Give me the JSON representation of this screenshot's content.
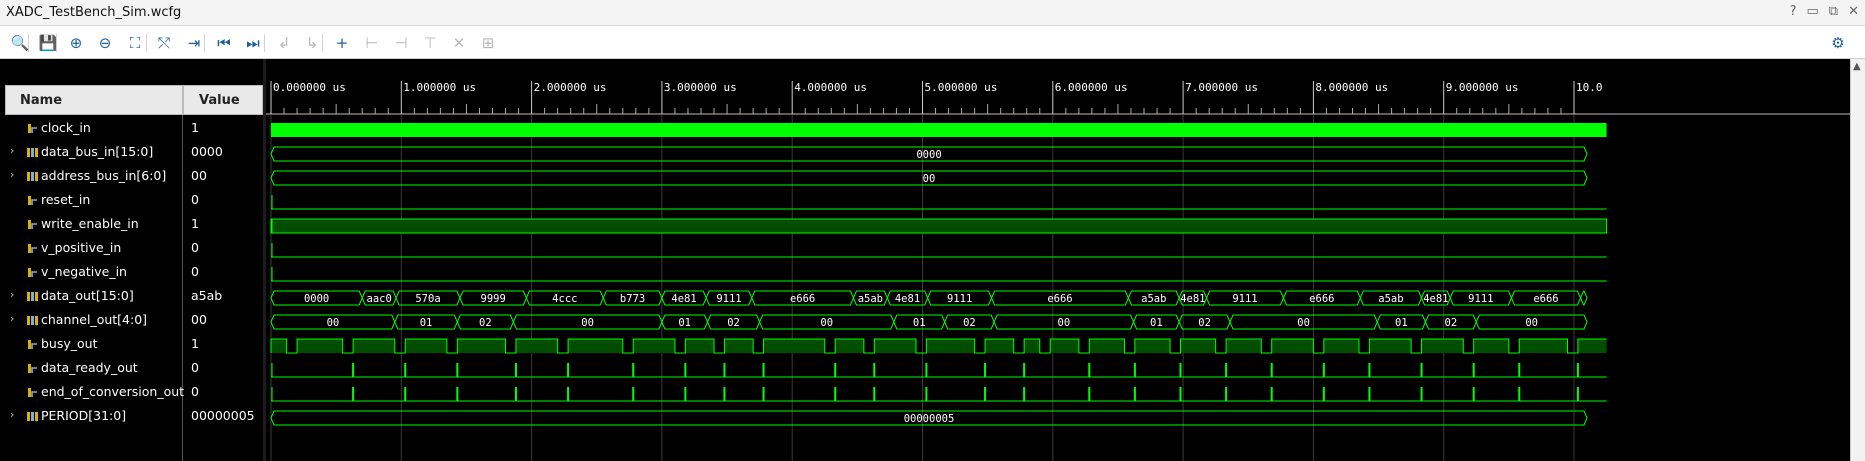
{
  "window": {
    "title": "XADC_TestBench_Sim.wcfg",
    "controls": [
      "?",
      "▭",
      "⧉",
      "✕"
    ]
  },
  "toolbar": {
    "buttons": [
      {
        "name": "search-icon",
        "glyph": "🔍",
        "enabled": true
      },
      {
        "name": "save-icon",
        "glyph": "💾",
        "enabled": true
      },
      {
        "name": "zoom-in-icon",
        "glyph": "⊕",
        "enabled": true
      },
      {
        "name": "zoom-out-icon",
        "glyph": "⊖",
        "enabled": true
      },
      {
        "name": "zoom-fit-icon",
        "glyph": "⛶",
        "enabled": true
      },
      {
        "name": "swap-cursor-icon",
        "glyph": "⤲",
        "enabled": true
      },
      {
        "name": "goto-cursor-icon",
        "glyph": "⇥",
        "enabled": true
      },
      {
        "name": "goto-start-icon",
        "glyph": "⏮",
        "enabled": true
      },
      {
        "name": "goto-end-icon",
        "glyph": "⏭",
        "enabled": true
      },
      {
        "name": "previous-transition-icon",
        "glyph": "↲",
        "enabled": false
      },
      {
        "name": "next-transition-icon",
        "glyph": "↳",
        "enabled": false
      },
      {
        "name": "add-marker-icon",
        "glyph": "+",
        "enabled": true
      },
      {
        "name": "previous-marker-icon",
        "glyph": "⊢",
        "enabled": false
      },
      {
        "name": "next-marker-icon",
        "glyph": "⊣",
        "enabled": false
      },
      {
        "name": "swap-marker-icon",
        "glyph": "⊤",
        "enabled": false
      },
      {
        "name": "delete-marker-icon",
        "glyph": "✕",
        "enabled": false
      },
      {
        "name": "snap-icon",
        "glyph": "⊞",
        "enabled": false
      }
    ],
    "settings_glyph": "⚙"
  },
  "columns": {
    "name": "Name",
    "value": "Value"
  },
  "signals": [
    {
      "name": "clock_in",
      "value": "1",
      "kind": "bit",
      "expandable": false
    },
    {
      "name": "data_bus_in[15:0]",
      "value": "0000",
      "kind": "bus",
      "expandable": true
    },
    {
      "name": "address_bus_in[6:0]",
      "value": "00",
      "kind": "bus",
      "expandable": true
    },
    {
      "name": "reset_in",
      "value": "0",
      "kind": "bit",
      "expandable": false
    },
    {
      "name": "write_enable_in",
      "value": "1",
      "kind": "bit",
      "expandable": false
    },
    {
      "name": "v_positive_in",
      "value": "0",
      "kind": "bit",
      "expandable": false
    },
    {
      "name": "v_negative_in",
      "value": "0",
      "kind": "bit",
      "expandable": false
    },
    {
      "name": "data_out[15:0]",
      "value": "a5ab",
      "kind": "bus",
      "expandable": true
    },
    {
      "name": "channel_out[4:0]",
      "value": "00",
      "kind": "bus",
      "expandable": true
    },
    {
      "name": "busy_out",
      "value": "1",
      "kind": "bit",
      "expandable": false
    },
    {
      "name": "data_ready_out",
      "value": "0",
      "kind": "bit",
      "expandable": false
    },
    {
      "name": "end_of_conversion_out",
      "value": "0",
      "kind": "bit",
      "expandable": false
    },
    {
      "name": "PERIOD[31:0]",
      "value": "00000005",
      "kind": "bus",
      "expandable": true
    }
  ],
  "time_axis": {
    "unit": "us",
    "labels": [
      "0.000000 us",
      "1.000000 us",
      "2.000000 us",
      "3.000000 us",
      "4.000000 us",
      "5.000000 us",
      "6.000000 us",
      "7.000000 us",
      "8.000000 us",
      "9.000000 us",
      "10.0"
    ]
  },
  "colors": {
    "wave": "#00ff00",
    "wave_dim": "#0a8a0a",
    "fill": "#004d00",
    "grid": "#3a3a3a",
    "axis_text": "#ffffff"
  },
  "waves": {
    "clock_in": {
      "type": "clock-dense"
    },
    "data_bus_in": {
      "segments": [
        {
          "start_us": 0,
          "end_us": 10.1,
          "label": "0000"
        }
      ]
    },
    "address_bus_in": {
      "segments": [
        {
          "start_us": 0,
          "end_us": 10.1,
          "label": "00"
        }
      ]
    },
    "reset_in": {
      "type": "constant",
      "level": 0
    },
    "write_enable_in": {
      "type": "constant",
      "level": 1
    },
    "v_positive_in": {
      "type": "constant",
      "level": 0
    },
    "v_negative_in": {
      "type": "constant",
      "level": 0
    },
    "data_out": {
      "segments": [
        {
          "start_us": 0.0,
          "end_us": 0.7,
          "label": "0000"
        },
        {
          "start_us": 0.7,
          "end_us": 0.96,
          "label": "aac0"
        },
        {
          "start_us": 0.96,
          "end_us": 1.45,
          "label": "570a"
        },
        {
          "start_us": 1.45,
          "end_us": 1.96,
          "label": "9999"
        },
        {
          "start_us": 1.96,
          "end_us": 2.55,
          "label": "4ccc"
        },
        {
          "start_us": 2.55,
          "end_us": 3.0,
          "label": "b773"
        },
        {
          "start_us": 3.0,
          "end_us": 3.34,
          "label": "4e81"
        },
        {
          "start_us": 3.34,
          "end_us": 3.69,
          "label": "9111"
        },
        {
          "start_us": 3.69,
          "end_us": 4.47,
          "label": "e666"
        },
        {
          "start_us": 4.47,
          "end_us": 4.73,
          "label": "a5ab"
        },
        {
          "start_us": 4.73,
          "end_us": 5.04,
          "label": "4e81"
        },
        {
          "start_us": 5.04,
          "end_us": 5.53,
          "label": "9111"
        },
        {
          "start_us": 5.53,
          "end_us": 6.58,
          "label": "e666"
        },
        {
          "start_us": 6.58,
          "end_us": 6.97,
          "label": "a5ab"
        },
        {
          "start_us": 6.97,
          "end_us": 7.18,
          "label": "4e81"
        },
        {
          "start_us": 7.18,
          "end_us": 7.77,
          "label": "9111"
        },
        {
          "start_us": 7.77,
          "end_us": 8.36,
          "label": "e666"
        },
        {
          "start_us": 8.36,
          "end_us": 8.83,
          "label": "a5ab"
        },
        {
          "start_us": 8.83,
          "end_us": 9.05,
          "label": "4e81"
        },
        {
          "start_us": 9.05,
          "end_us": 9.52,
          "label": "9111"
        },
        {
          "start_us": 9.52,
          "end_us": 10.05,
          "label": "e666"
        },
        {
          "start_us": 10.05,
          "end_us": 10.1,
          "label": ""
        }
      ]
    },
    "channel_out": {
      "segments": [
        {
          "start_us": 0.0,
          "end_us": 0.95,
          "label": "00"
        },
        {
          "start_us": 0.95,
          "end_us": 1.43,
          "label": "01"
        },
        {
          "start_us": 1.43,
          "end_us": 1.86,
          "label": "02"
        },
        {
          "start_us": 1.86,
          "end_us": 3.0,
          "label": "00"
        },
        {
          "start_us": 3.0,
          "end_us": 3.35,
          "label": "01"
        },
        {
          "start_us": 3.35,
          "end_us": 3.75,
          "label": "02"
        },
        {
          "start_us": 3.75,
          "end_us": 4.78,
          "label": "00"
        },
        {
          "start_us": 4.78,
          "end_us": 5.17,
          "label": "01"
        },
        {
          "start_us": 5.17,
          "end_us": 5.55,
          "label": "02"
        },
        {
          "start_us": 5.55,
          "end_us": 6.62,
          "label": "00"
        },
        {
          "start_us": 6.62,
          "end_us": 6.97,
          "label": "01"
        },
        {
          "start_us": 6.97,
          "end_us": 7.36,
          "label": "02"
        },
        {
          "start_us": 7.36,
          "end_us": 8.49,
          "label": "00"
        },
        {
          "start_us": 8.49,
          "end_us": 8.86,
          "label": "01"
        },
        {
          "start_us": 8.86,
          "end_us": 9.25,
          "label": "02"
        },
        {
          "start_us": 9.25,
          "end_us": 10.1,
          "label": "00"
        }
      ]
    },
    "busy_out": {
      "low_us": [
        [
          0.12,
          0.2
        ],
        [
          0.55,
          0.63
        ],
        [
          0.95,
          1.03
        ],
        [
          1.35,
          1.43
        ],
        [
          1.8,
          1.88
        ],
        [
          2.2,
          2.28
        ],
        [
          2.7,
          2.78
        ],
        [
          3.1,
          3.18
        ],
        [
          3.4,
          3.48
        ],
        [
          3.7,
          3.78
        ],
        [
          4.25,
          4.33
        ],
        [
          4.55,
          4.63
        ],
        [
          4.95,
          5.03
        ],
        [
          5.4,
          5.48
        ],
        [
          5.7,
          5.78
        ],
        [
          5.9,
          5.98
        ],
        [
          6.2,
          6.28
        ],
        [
          6.55,
          6.63
        ],
        [
          6.9,
          6.98
        ],
        [
          7.25,
          7.33
        ],
        [
          7.6,
          7.68
        ],
        [
          8.0,
          8.08
        ],
        [
          8.35,
          8.43
        ],
        [
          8.75,
          8.83
        ],
        [
          9.15,
          9.23
        ],
        [
          9.5,
          9.58
        ],
        [
          9.95,
          10.03
        ]
      ]
    },
    "data_ready_out": {
      "pulses_us": [
        0.63,
        1.03,
        1.43,
        1.88,
        2.28,
        2.78,
        3.18,
        3.48,
        3.78,
        4.33,
        4.63,
        5.03,
        5.48,
        5.78,
        6.28,
        6.63,
        6.98,
        7.33,
        7.68,
        8.08,
        8.43,
        8.83,
        9.23,
        9.58,
        10.03
      ]
    },
    "end_of_conversion_out": {
      "pulses_us": [
        0.63,
        1.03,
        1.43,
        1.88,
        2.28,
        2.78,
        3.18,
        3.48,
        3.78,
        4.33,
        4.63,
        5.03,
        5.48,
        5.78,
        6.28,
        6.63,
        6.98,
        7.33,
        7.68,
        8.08,
        8.43,
        8.83,
        9.23,
        9.58,
        10.03
      ]
    },
    "PERIOD": {
      "segments": [
        {
          "start_us": 0,
          "end_us": 10.1,
          "label": "00000005"
        }
      ]
    }
  }
}
